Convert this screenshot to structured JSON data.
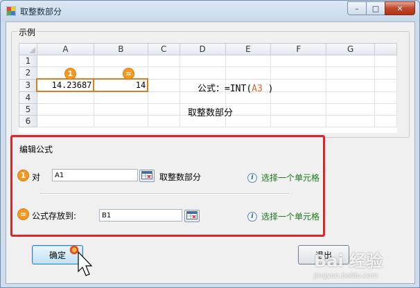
{
  "window": {
    "title": "取整数部分",
    "controls": {
      "minimize": "–",
      "maximize": "□",
      "close": "✕"
    }
  },
  "example": {
    "group_label": "示例",
    "columns": [
      "A",
      "B",
      "C",
      "D",
      "E",
      "F",
      "G"
    ],
    "rows": [
      "1",
      "2",
      "3",
      "4",
      "5",
      "6"
    ],
    "cell_a3": "14.23687",
    "cell_b3": "14",
    "marker_1": "1",
    "marker_2": "=",
    "formula_prefix": "公式：",
    "formula_head": "=INT(",
    "formula_ref": "A3",
    "formula_tail": " )",
    "caption": "取整数部分"
  },
  "edit": {
    "group_label": "编辑公式",
    "row1": {
      "marker": "1",
      "label": "对",
      "value": "A1",
      "suffix": "取整数部分",
      "hint": "选择一个单元格"
    },
    "row2": {
      "marker": "=",
      "label": "公式存放到:",
      "value": "B1",
      "hint": "选择一个单元格"
    }
  },
  "buttons": {
    "ok": "确定",
    "exit": "退出"
  },
  "watermark": {
    "brand": "Bai 经验",
    "url": "jingyan.baidu.com"
  },
  "colors": {
    "accent_orange": "#f39a1e",
    "highlight_red": "#e0242e",
    "hint_green": "#1a7a1a"
  }
}
